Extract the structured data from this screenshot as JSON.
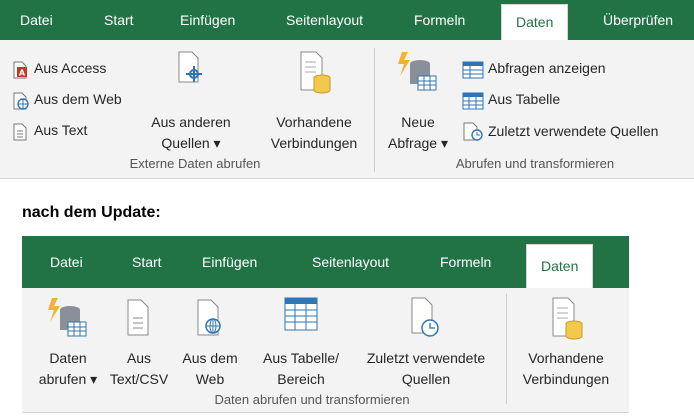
{
  "ribbon_old": {
    "tabs": [
      "Datei",
      "Start",
      "Einfügen",
      "Seitenlayout",
      "Formeln",
      "Daten",
      "Überprüfen"
    ],
    "active_tab": "Daten",
    "external": {
      "aus_access": "Aus Access",
      "aus_web": "Aus dem Web",
      "aus_text": "Aus Text",
      "aus_anderen_1": "Aus anderen",
      "aus_anderen_2": "Quellen ▾",
      "vorhandene_1": "Vorhandene",
      "vorhandene_2": "Verbindungen",
      "group_label": "Externe Daten abrufen"
    },
    "transform": {
      "neue_1": "Neue",
      "neue_2": "Abfrage ▾",
      "abfragen": "Abfragen anzeigen",
      "aus_tabelle": "Aus Tabelle",
      "zuletzt": "Zuletzt verwendete Quellen",
      "group_label": "Abrufen und transformieren"
    }
  },
  "heading": "nach dem Update:",
  "ribbon_new": {
    "tabs": [
      "Datei",
      "Start",
      "Einfügen",
      "Seitenlayout",
      "Formeln",
      "Daten"
    ],
    "active_tab": "Daten",
    "buttons": {
      "daten_1": "Daten",
      "daten_2": "abrufen ▾",
      "aus_text_1": "Aus",
      "aus_text_2": "Text/CSV",
      "aus_web_1": "Aus dem",
      "aus_web_2": "Web",
      "aus_tabelle_1": "Aus Tabelle/",
      "aus_tabelle_2": "Bereich",
      "zuletzt_1": "Zuletzt verwendete",
      "zuletzt_2": "Quellen",
      "vorhandene_1": "Vorhandene",
      "vorhandene_2": "Verbindungen"
    },
    "group_label": "Daten abrufen und transformieren"
  },
  "colors": {
    "excel_green": "#217346",
    "ribbon_bg": "#f3f3f3"
  }
}
